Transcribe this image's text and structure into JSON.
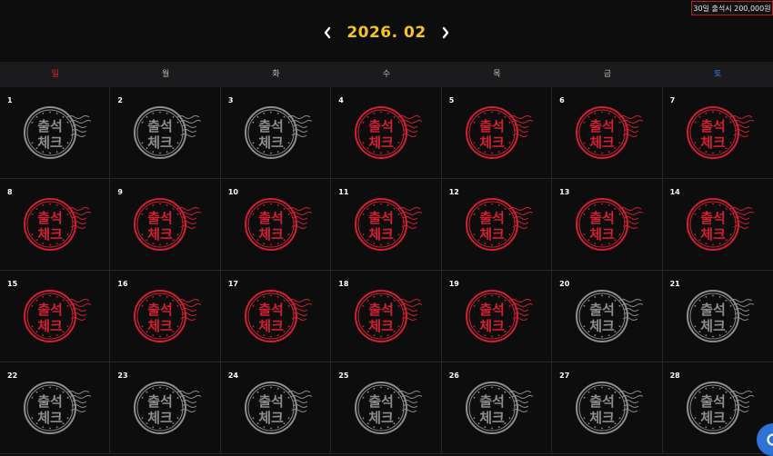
{
  "badge": {
    "text": "30일 출석시 200,000원"
  },
  "calendar": {
    "title": "2026. 02",
    "weekdays": [
      "일",
      "월",
      "화",
      "수",
      "목",
      "금",
      "토"
    ],
    "days": [
      {
        "day": "1",
        "checked": false
      },
      {
        "day": "2",
        "checked": false
      },
      {
        "day": "3",
        "checked": false
      },
      {
        "day": "4",
        "checked": true
      },
      {
        "day": "5",
        "checked": true
      },
      {
        "day": "6",
        "checked": true
      },
      {
        "day": "7",
        "checked": true
      },
      {
        "day": "8",
        "checked": true
      },
      {
        "day": "9",
        "checked": true
      },
      {
        "day": "10",
        "checked": true
      },
      {
        "day": "11",
        "checked": true
      },
      {
        "day": "12",
        "checked": true
      },
      {
        "day": "13",
        "checked": true
      },
      {
        "day": "14",
        "checked": true
      },
      {
        "day": "15",
        "checked": true
      },
      {
        "day": "16",
        "checked": true
      },
      {
        "day": "17",
        "checked": true
      },
      {
        "day": "18",
        "checked": true
      },
      {
        "day": "19",
        "checked": true
      },
      {
        "day": "20",
        "checked": false
      },
      {
        "day": "21",
        "checked": false
      },
      {
        "day": "22",
        "checked": false
      },
      {
        "day": "23",
        "checked": false
      },
      {
        "day": "24",
        "checked": false
      },
      {
        "day": "25",
        "checked": false
      },
      {
        "day": "26",
        "checked": false
      },
      {
        "day": "27",
        "checked": false
      },
      {
        "day": "28",
        "checked": false
      }
    ]
  },
  "stamp": {
    "line1": "출석",
    "line2": "체크"
  },
  "colors": {
    "accent_title": "#f4c522",
    "stamp_checked": "#d11f33",
    "stamp_unchecked": "#8d8d8d",
    "sunday": "#e2262e",
    "saturday": "#2f86e6",
    "chat_button": "#2f72d6"
  },
  "icons": {
    "prev": "chevron-left-icon",
    "next": "chevron-right-icon",
    "chat": "chat-icon"
  }
}
